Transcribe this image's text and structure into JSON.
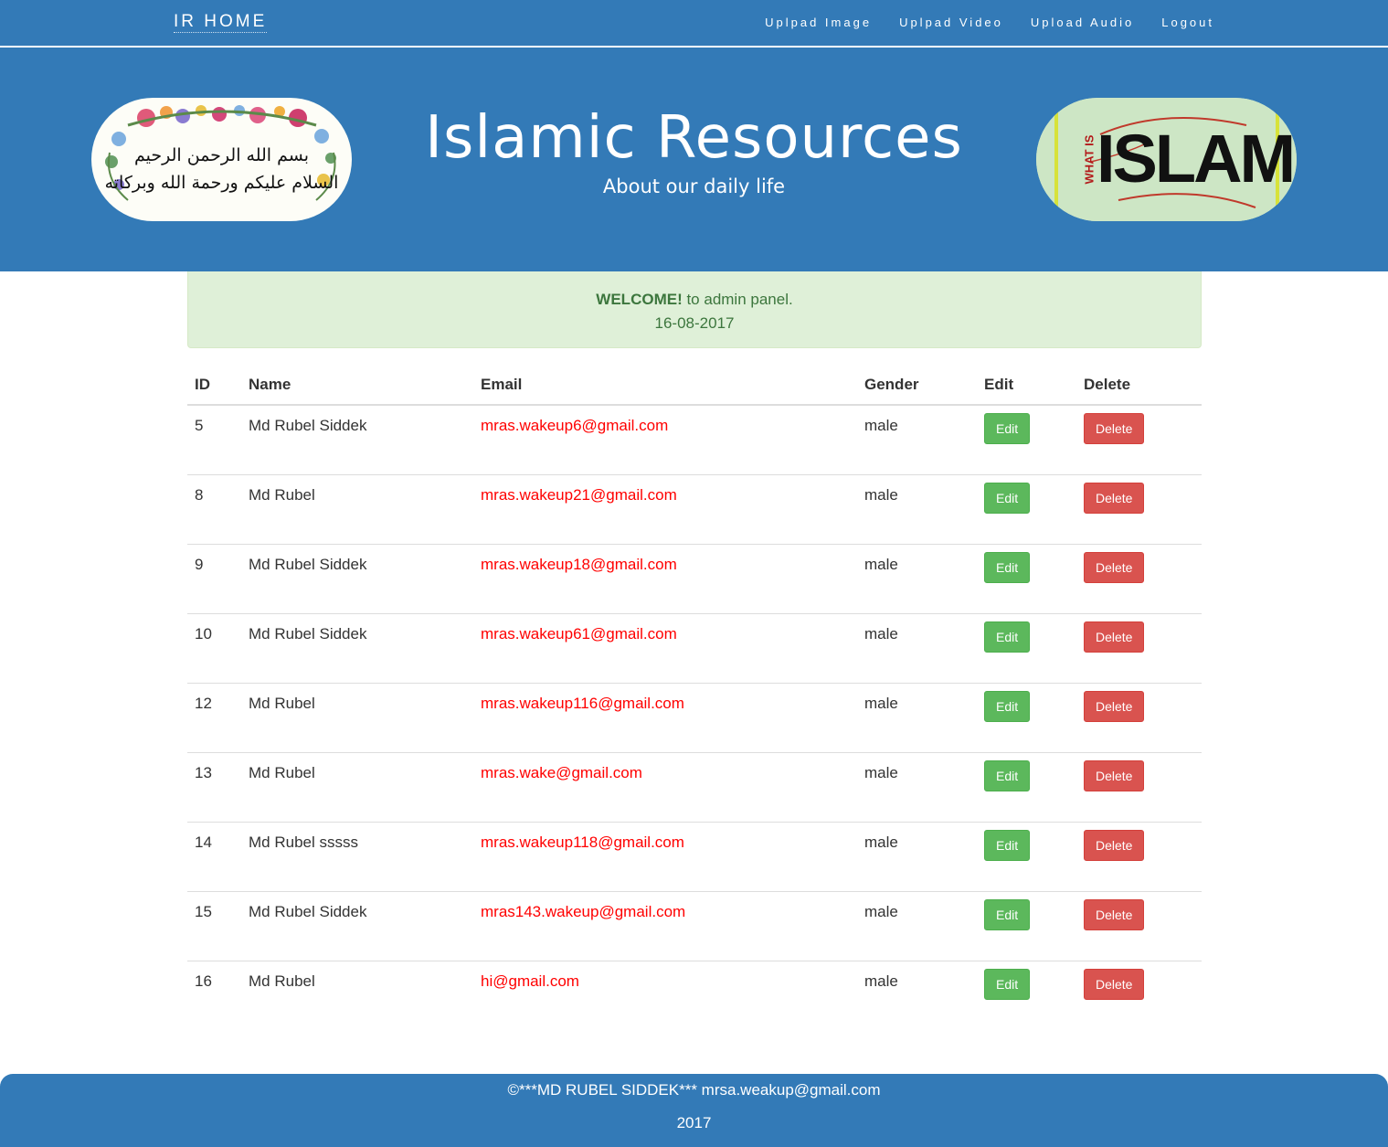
{
  "nav": {
    "brand": "IR HOME",
    "links": [
      "Uplpad Image",
      "Uplpad Video",
      "Upload Audio",
      "Logout"
    ]
  },
  "header": {
    "title": "Islamic Resources",
    "subtitle": "About our daily life",
    "left_logo_text": [
      "بسم الله الرحمن الرحيم",
      "السلام عليكم ورحمة الله وبركاته"
    ],
    "right_logo_small": "WHAT IS",
    "right_logo_big": "ISLAM"
  },
  "alert": {
    "strong": "WELCOME!",
    "text": " to admin panel.",
    "date": "16-08-2017"
  },
  "table": {
    "headers": [
      "ID",
      "Name",
      "Email",
      "Gender",
      "Edit",
      "Delete"
    ],
    "edit_label": "Edit",
    "delete_label": "Delete",
    "rows": [
      {
        "id": "5",
        "name": "Md Rubel Siddek",
        "email": "mras.wakeup6@gmail.com",
        "gender": "male"
      },
      {
        "id": "8",
        "name": "Md Rubel",
        "email": "mras.wakeup21@gmail.com",
        "gender": "male"
      },
      {
        "id": "9",
        "name": "Md Rubel Siddek",
        "email": "mras.wakeup18@gmail.com",
        "gender": "male"
      },
      {
        "id": "10",
        "name": "Md Rubel Siddek",
        "email": "mras.wakeup61@gmail.com",
        "gender": "male"
      },
      {
        "id": "12",
        "name": "Md Rubel",
        "email": "mras.wakeup116@gmail.com",
        "gender": "male"
      },
      {
        "id": "13",
        "name": "Md Rubel",
        "email": "mras.wake@gmail.com",
        "gender": "male"
      },
      {
        "id": "14",
        "name": "Md Rubel sssss",
        "email": "mras.wakeup118@gmail.com",
        "gender": "male"
      },
      {
        "id": "15",
        "name": "Md Rubel Siddek",
        "email": "mras143.wakeup@gmail.com",
        "gender": "male"
      },
      {
        "id": "16",
        "name": "Md Rubel",
        "email": "hi@gmail.com",
        "gender": "male"
      }
    ]
  },
  "footer": {
    "line1": "©***MD RUBEL SIDDEK*** mrsa.weakup@gmail.com",
    "line2": "2017"
  },
  "colors": {
    "primary": "#337ab7",
    "success": "#5cb85c",
    "danger": "#d9534f",
    "alert_bg": "#dff0d8",
    "email": "#ff0000"
  }
}
